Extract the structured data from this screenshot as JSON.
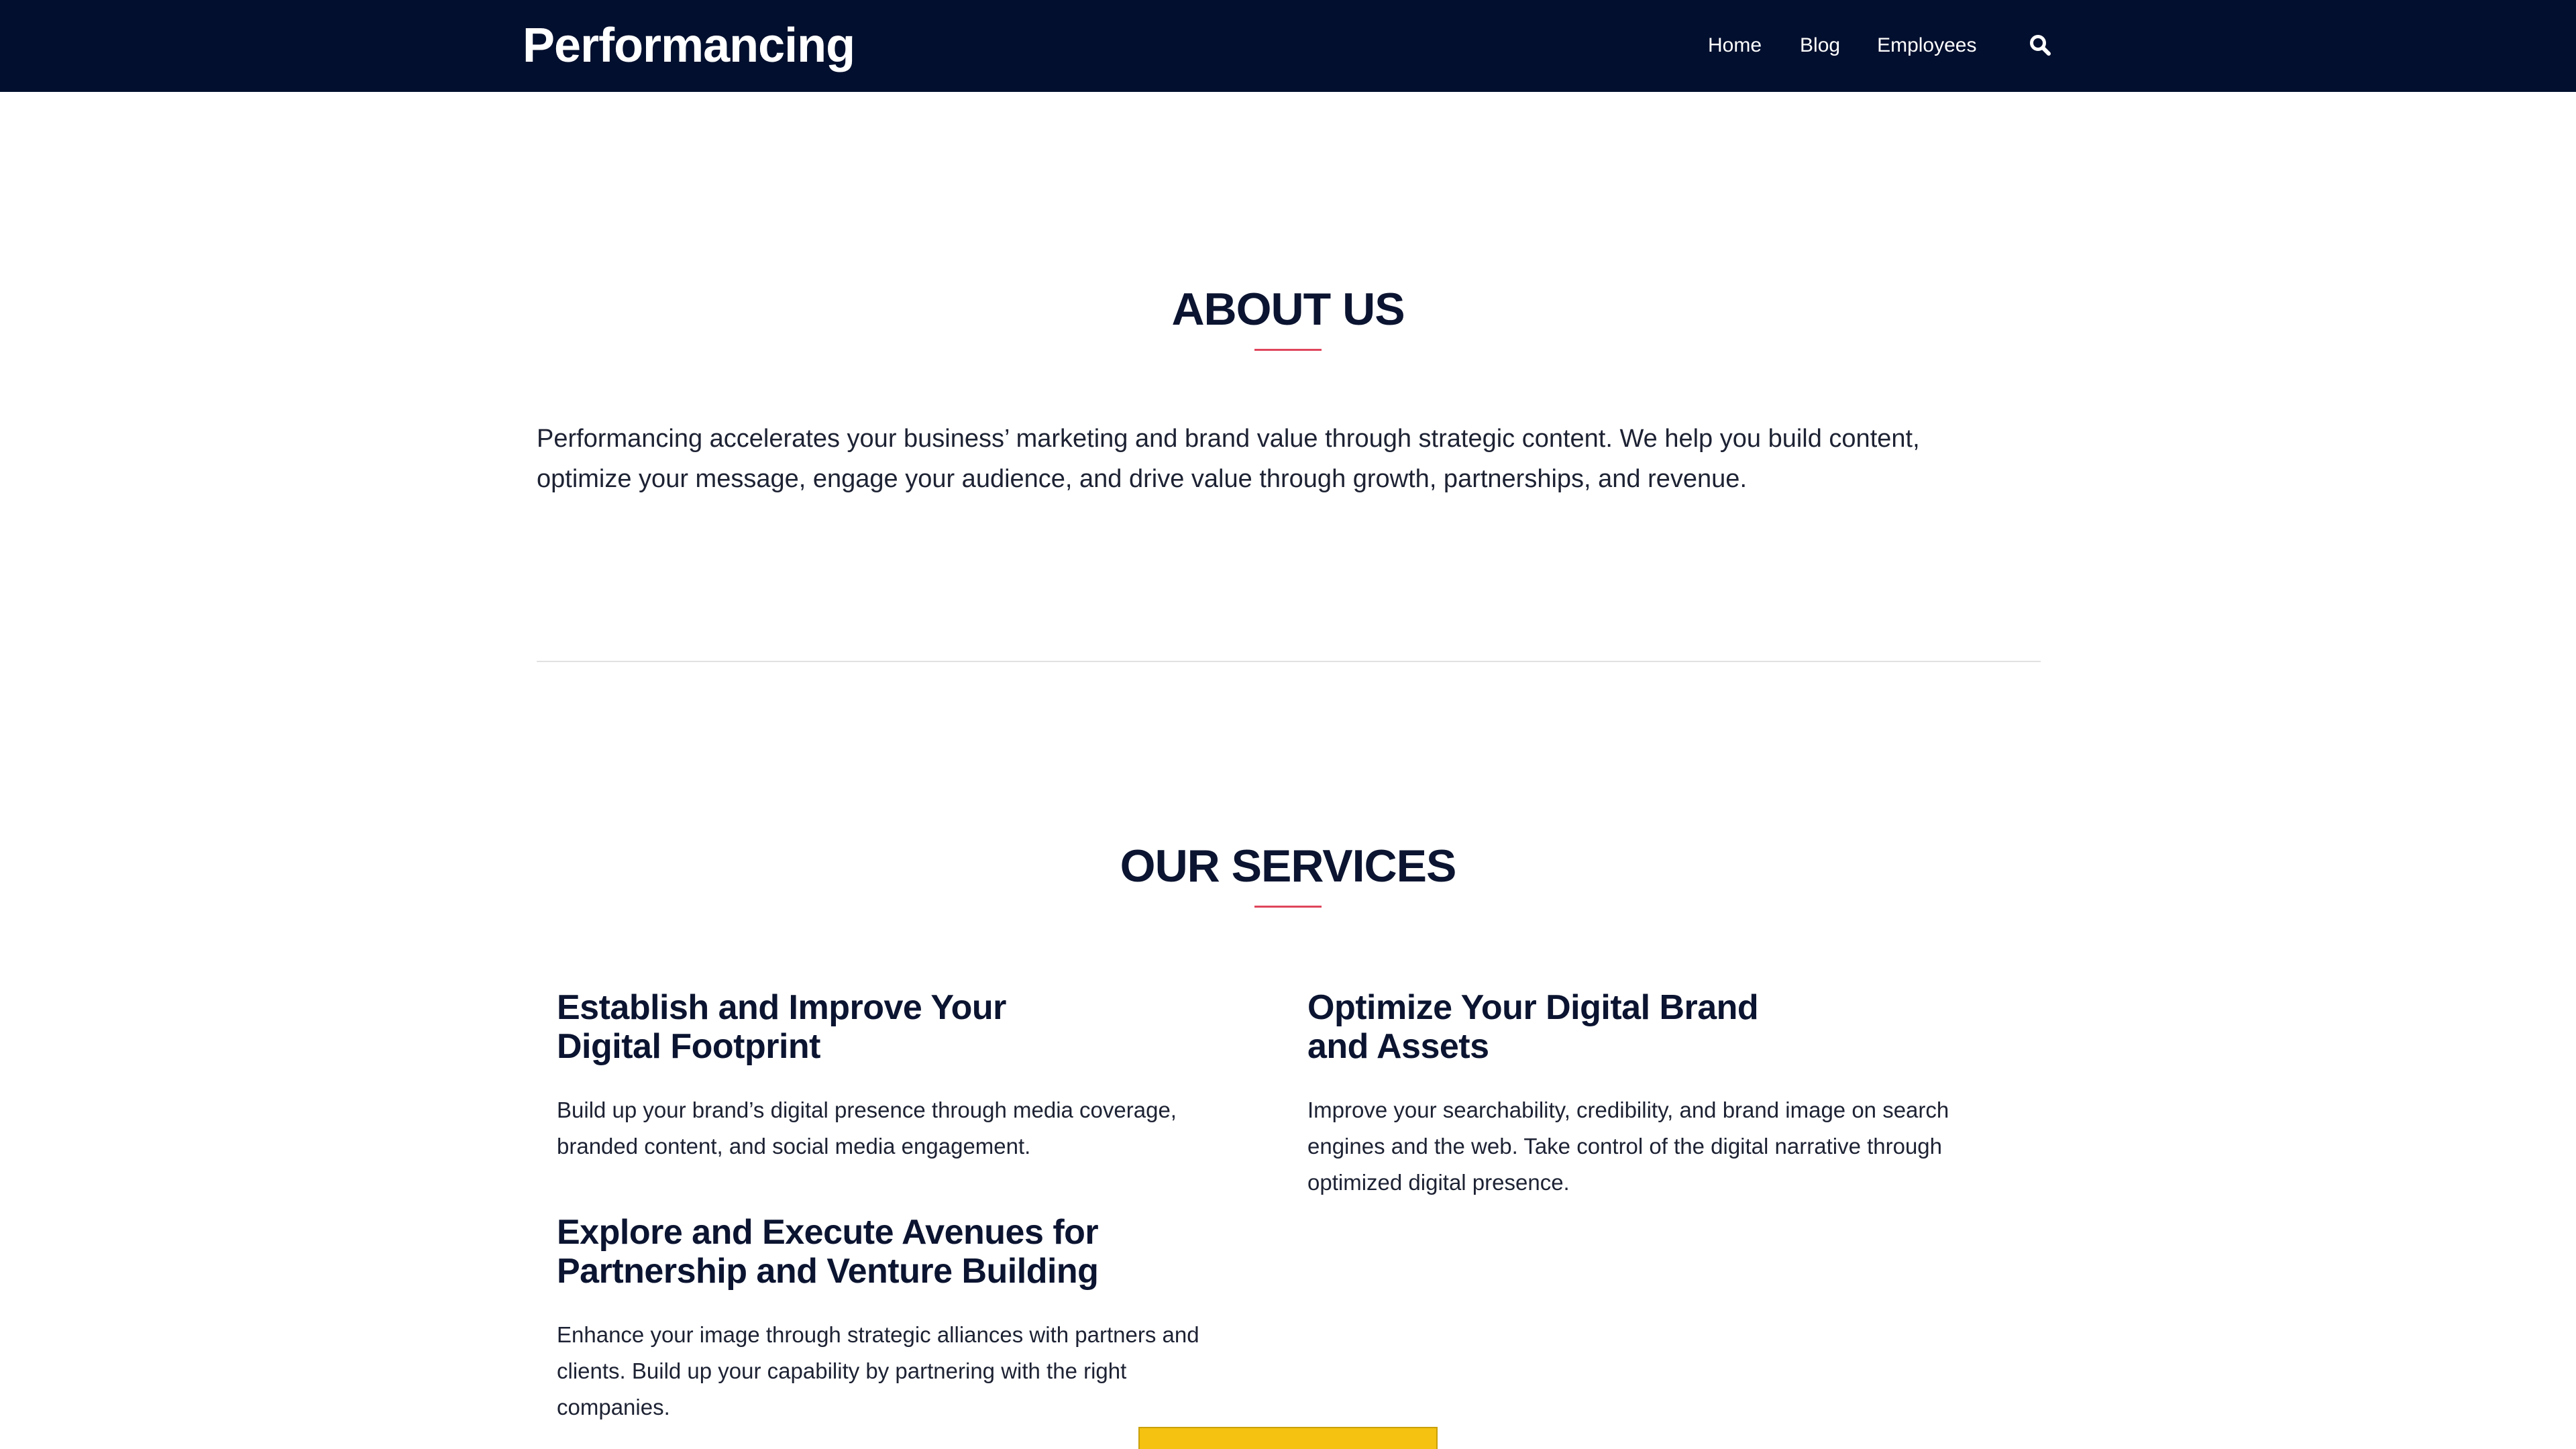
{
  "header": {
    "brand": "Performancing",
    "nav": {
      "home": "Home",
      "blog": "Blog",
      "employees": "Employees"
    },
    "search_icon": "search-icon"
  },
  "about": {
    "title": "ABOUT US",
    "line1": "Performancing accelerates your business’ marketing and brand value through strategic content. We help you build content,",
    "line2": "optimize your message, engage your audience, and drive value through growth, partnerships, and revenue."
  },
  "services": {
    "title": "OUR SERVICES",
    "items": [
      {
        "heading_line1": "Establish and Improve Your",
        "heading_line2": "Digital Footprint",
        "text_line1": "Build up your brand’s digital presence through media coverage,",
        "text_line2": "branded content, and social media engagement.",
        "text_line3": ""
      },
      {
        "heading_line1": "Optimize Your Digital Brand",
        "heading_line2": "and Assets",
        "text_line1": "Improve your searchability, credibility, and brand image on search",
        "text_line2": "engines and the web. Take control of the digital narrative through",
        "text_line3": "optimized digital presence."
      },
      {
        "heading_line1": "Explore and Execute Avenues for",
        "heading_line2": "Partnership and Venture Building",
        "text_line1": "Enhance your image through strategic alliances with partners and",
        "text_line2": "clients. Build up your capability by partnering with the right",
        "text_line3": "companies."
      }
    ]
  },
  "colors": {
    "header_bg": "#020f2e",
    "accent_underline": "#e0455c",
    "cta_yellow": "#f5c211"
  }
}
